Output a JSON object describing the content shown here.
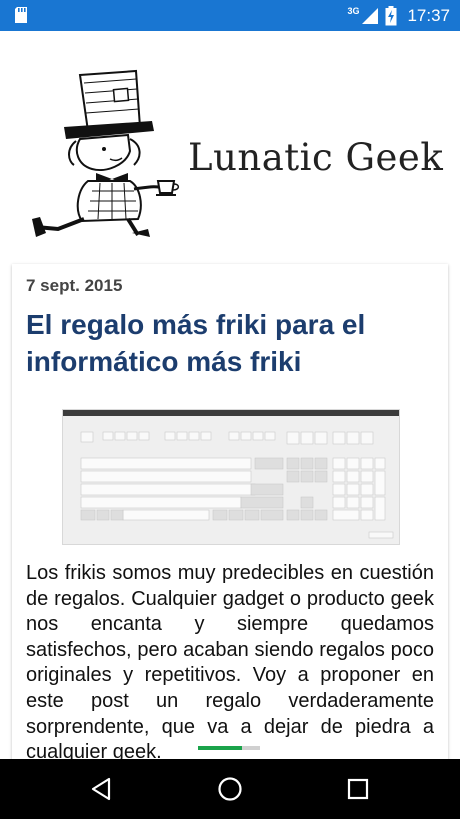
{
  "status_bar": {
    "network": "3G",
    "time": "17:37",
    "colors": {
      "background": "#1976D2"
    }
  },
  "header": {
    "site_title": "Lunatic Geek"
  },
  "post": {
    "date": "7 sept. 2015",
    "title": "El regalo más friki para el informático más friki",
    "body": "Los frikis somos muy predecibles en cuestión de regalos. Cualquier gadget o producto geek nos encanta y siempre quedamos satisfechos, pero acaban siendo regalos poco originales y repetitivos. Voy a proponer en este post un regalo verdaderamente sorprendente, que va a dejar de piedra a cualquier geek."
  },
  "navigation": {
    "back": "back-icon",
    "home": "home-icon",
    "recents": "recents-icon"
  }
}
